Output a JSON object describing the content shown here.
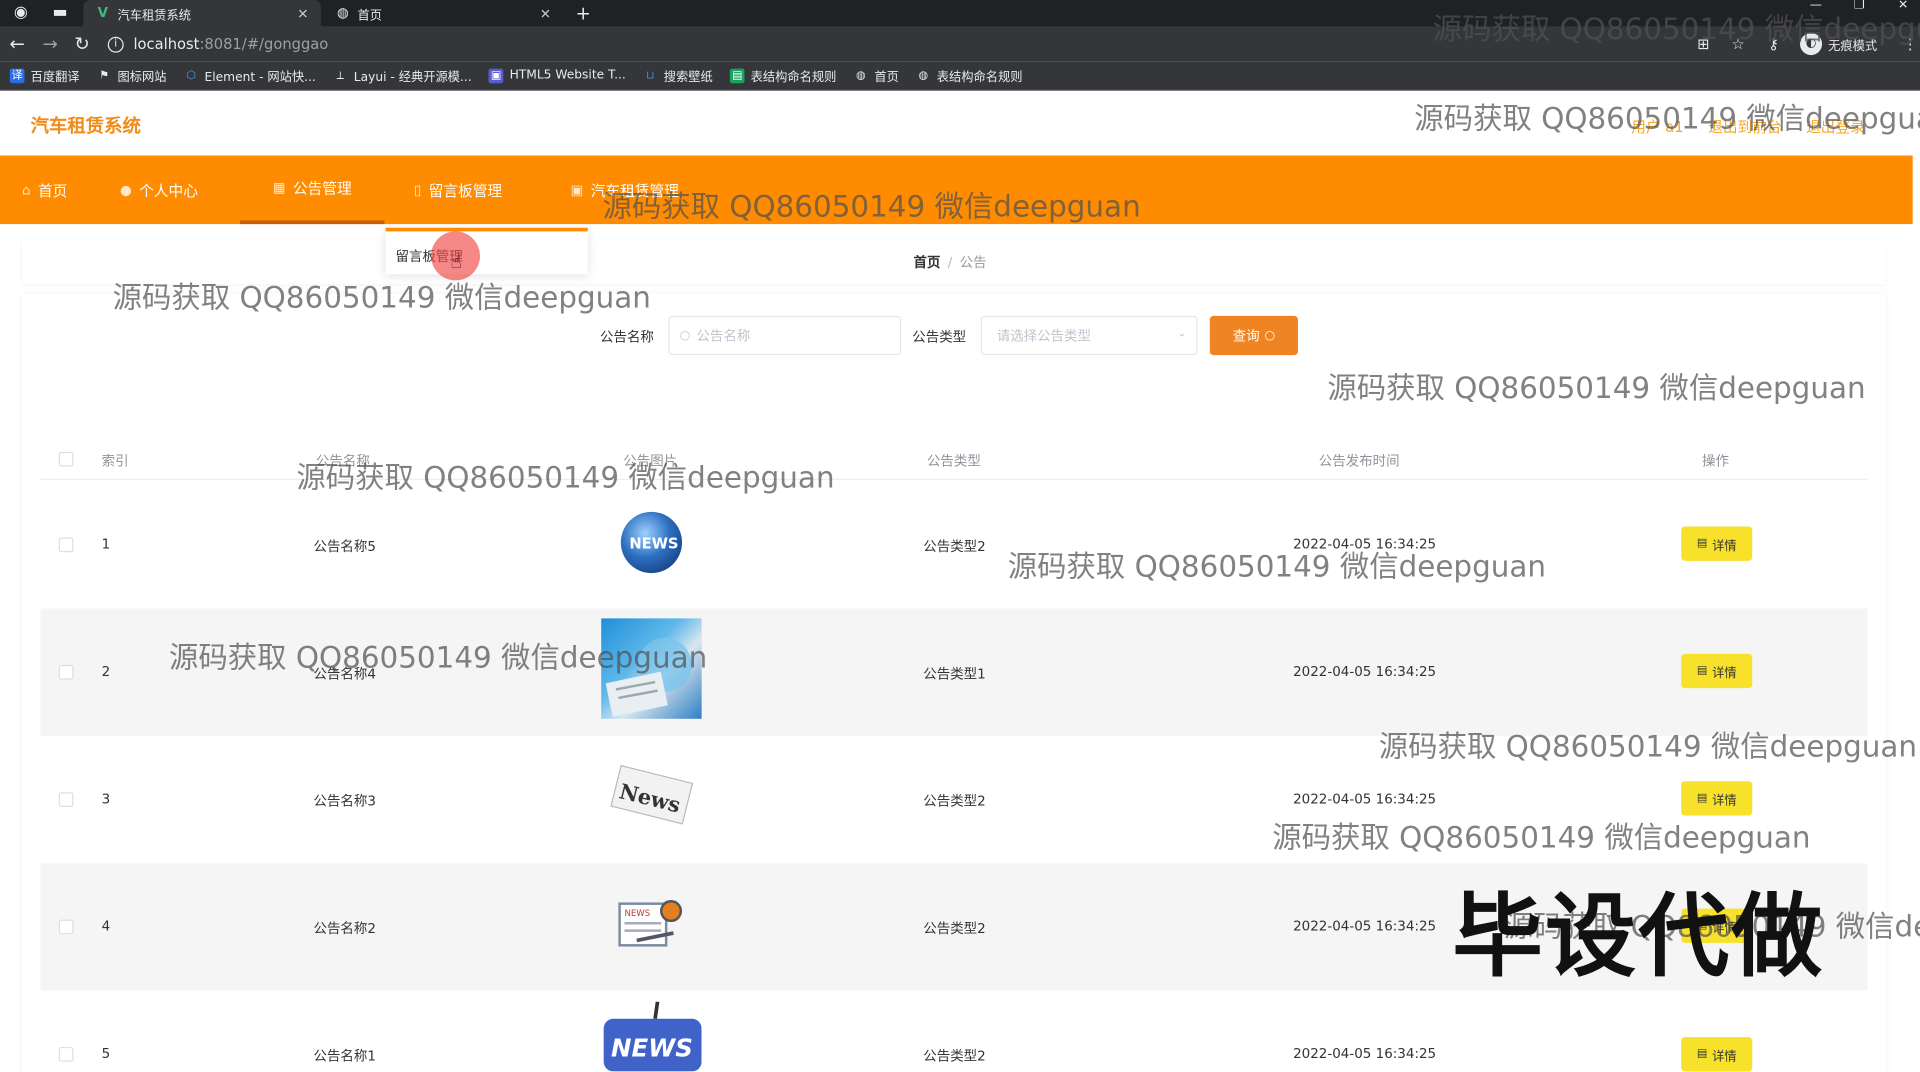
{
  "browser": {
    "tabs": [
      {
        "title": "汽车租赁系统",
        "active": true
      },
      {
        "title": "首页",
        "active": false
      }
    ],
    "url_host": "localhost",
    "url_path": ":8081/#/gonggao",
    "profile_label": "无痕模式",
    "bookmarks": [
      {
        "label": "百度翻译",
        "color": "#2b6de5"
      },
      {
        "label": "图标网站",
        "color": "#e8eaed"
      },
      {
        "label": "Element - 网站快...",
        "color": "#409eff"
      },
      {
        "label": "Layui - 经典开源模...",
        "color": "#e8eaed"
      },
      {
        "label": "HTML5 Website T...",
        "color": "#5b5bd6"
      },
      {
        "label": "搜索壁纸",
        "color": "#3c8dde"
      },
      {
        "label": "表结构命名规则",
        "color": "#1aa260"
      },
      {
        "label": "首页",
        "color": "#e8eaed"
      },
      {
        "label": "表结构命名规则",
        "color": "#e8eaed"
      }
    ]
  },
  "app": {
    "title": "汽车租赁系统",
    "header_links": [
      "用户 a1",
      "退出到前台",
      "退出登录"
    ],
    "nav": [
      {
        "label": "首页",
        "icon": "home-icon"
      },
      {
        "label": "个人中心",
        "icon": "user-icon"
      },
      {
        "label": "公告管理",
        "icon": "notice-icon"
      },
      {
        "label": "留言板管理",
        "icon": "message-icon"
      },
      {
        "label": "汽车租赁管理",
        "icon": "car-icon"
      }
    ],
    "dropdown_item": "留言板管理",
    "breadcrumb": {
      "home": "首页",
      "sep": "/",
      "current": "公告"
    },
    "search": {
      "name_label": "公告名称",
      "name_placeholder": "公告名称",
      "type_label": "公告类型",
      "type_placeholder": "请选择公告类型",
      "query_label": "查询"
    },
    "table": {
      "headers": [
        "索引",
        "公告名称",
        "公告图片",
        "公告类型",
        "公告发布时间",
        "操作"
      ],
      "rows": [
        {
          "index": "1",
          "name": "公告名称5",
          "type": "公告类型2",
          "time": "2022-04-05 16:34:25",
          "image": "globe-news-image"
        },
        {
          "index": "2",
          "name": "公告名称4",
          "type": "公告类型1",
          "time": "2022-04-05 16:34:25",
          "image": "newspaper-news-image"
        },
        {
          "index": "3",
          "name": "公告名称3",
          "type": "公告类型2",
          "time": "2022-04-05 16:34:25",
          "image": "news-stamp-image"
        },
        {
          "index": "4",
          "name": "公告名称2",
          "type": "公告类型2",
          "time": "2022-04-05 16:34:25",
          "image": "news-paper-icon-image"
        },
        {
          "index": "5",
          "name": "公告名称1",
          "type": "公告类型2",
          "time": "2022-04-05 16:34:25",
          "image": "news-sign-image"
        }
      ],
      "detail_label": "详情"
    }
  },
  "overlay": {
    "watermark": "源码获取 QQ86050149 微信deepguan",
    "big_text": "毕设代做"
  },
  "colors": {
    "brand_orange": "#ff8b00",
    "query_button": "#f08322",
    "detail_button": "#f7e12b"
  }
}
